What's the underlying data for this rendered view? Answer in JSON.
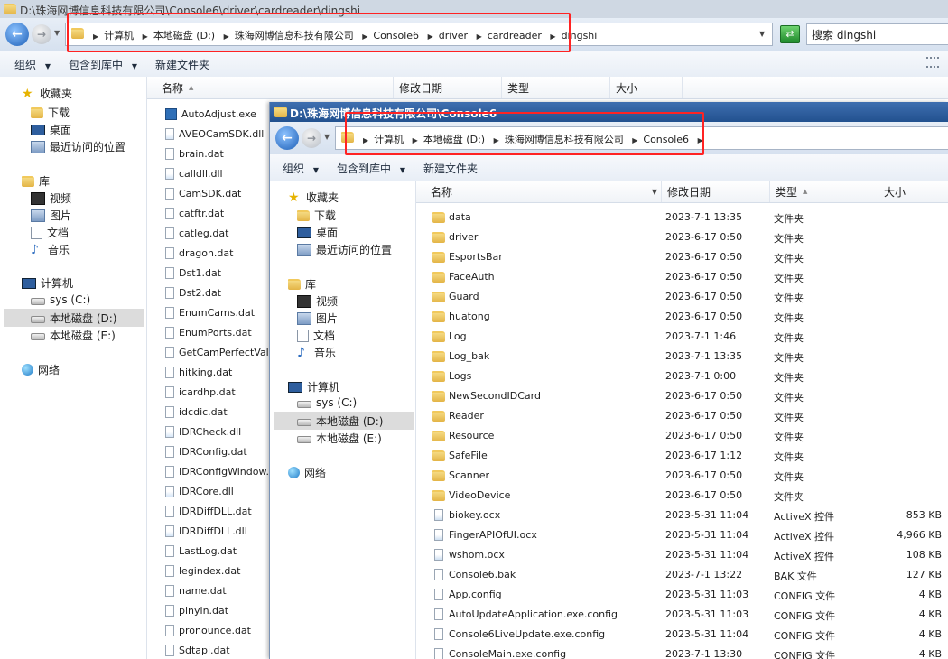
{
  "outer": {
    "title": "D:\\珠海网博信息科技有限公司\\Console6\\driver\\cardreader\\dingshi",
    "breadcrumbs": [
      "计算机",
      "本地磁盘 (D:)",
      "珠海网博信息科技有限公司",
      "Console6",
      "driver",
      "cardreader",
      "dingshi"
    ],
    "search_placeholder": "搜索 dingshi",
    "toolbar": {
      "organize": "组织",
      "include": "包含到库中",
      "new_folder": "新建文件夹"
    },
    "columns": [
      "名称",
      "修改日期",
      "类型",
      "大小"
    ],
    "nav": {
      "favorites": "收藏夹",
      "downloads": "下载",
      "desktop": "桌面",
      "recent": "最近访问的位置",
      "libraries": "库",
      "videos": "视频",
      "pictures": "图片",
      "documents": "文档",
      "music": "音乐",
      "computer": "计算机",
      "sys_c": "sys (C:)",
      "local_d": "本地磁盘 (D:)",
      "local_e": "本地磁盘 (E:)",
      "network": "网络"
    },
    "files": [
      {
        "name": "AutoAdjust.exe",
        "kind": "exe"
      },
      {
        "name": "AVEOCamSDK.dll",
        "kind": "dll"
      },
      {
        "name": "brain.dat",
        "kind": "dat"
      },
      {
        "name": "calldll.dll",
        "kind": "dll"
      },
      {
        "name": "CamSDK.dat",
        "kind": "dat"
      },
      {
        "name": "catftr.dat",
        "kind": "dat"
      },
      {
        "name": "catleg.dat",
        "kind": "dat"
      },
      {
        "name": "dragon.dat",
        "kind": "dat"
      },
      {
        "name": "Dst1.dat",
        "kind": "dat"
      },
      {
        "name": "Dst2.dat",
        "kind": "dat"
      },
      {
        "name": "EnumCams.dat",
        "kind": "dat"
      },
      {
        "name": "EnumPorts.dat",
        "kind": "dat"
      },
      {
        "name": "GetCamPerfectValue",
        "kind": "dat"
      },
      {
        "name": "hitking.dat",
        "kind": "dat"
      },
      {
        "name": "icardhp.dat",
        "kind": "dat"
      },
      {
        "name": "idcdic.dat",
        "kind": "dat"
      },
      {
        "name": "IDRCheck.dll",
        "kind": "dll"
      },
      {
        "name": "IDRConfig.dat",
        "kind": "dat"
      },
      {
        "name": "IDRConfigWindow.d",
        "kind": "dat"
      },
      {
        "name": "IDRCore.dll",
        "kind": "dll"
      },
      {
        "name": "IDRDiffDLL.dat",
        "kind": "dat"
      },
      {
        "name": "IDRDiffDLL.dll",
        "kind": "dll"
      },
      {
        "name": "LastLog.dat",
        "kind": "dat"
      },
      {
        "name": "legindex.dat",
        "kind": "dat"
      },
      {
        "name": "name.dat",
        "kind": "dat"
      },
      {
        "name": "pinyin.dat",
        "kind": "dat"
      },
      {
        "name": "pronounce.dat",
        "kind": "dat"
      },
      {
        "name": "Sdtapi.dat",
        "kind": "dat"
      }
    ]
  },
  "inner": {
    "title": "D:\\珠海网博信息科技有限公司\\Console6",
    "breadcrumbs": [
      "计算机",
      "本地磁盘 (D:)",
      "珠海网博信息科技有限公司",
      "Console6"
    ],
    "toolbar": {
      "organize": "组织",
      "include": "包含到库中",
      "new_folder": "新建文件夹"
    },
    "columns": [
      "名称",
      "修改日期",
      "类型",
      "大小"
    ],
    "rows": [
      {
        "name": "data",
        "date": "2023-7-1 13:35",
        "type": "文件夹",
        "size": "",
        "kind": "folder"
      },
      {
        "name": "driver",
        "date": "2023-6-17 0:50",
        "type": "文件夹",
        "size": "",
        "kind": "folder"
      },
      {
        "name": "EsportsBar",
        "date": "2023-6-17 0:50",
        "type": "文件夹",
        "size": "",
        "kind": "folder"
      },
      {
        "name": "FaceAuth",
        "date": "2023-6-17 0:50",
        "type": "文件夹",
        "size": "",
        "kind": "folder"
      },
      {
        "name": "Guard",
        "date": "2023-6-17 0:50",
        "type": "文件夹",
        "size": "",
        "kind": "folder"
      },
      {
        "name": "huatong",
        "date": "2023-6-17 0:50",
        "type": "文件夹",
        "size": "",
        "kind": "folder"
      },
      {
        "name": "Log",
        "date": "2023-7-1 1:46",
        "type": "文件夹",
        "size": "",
        "kind": "folder"
      },
      {
        "name": "Log_bak",
        "date": "2023-7-1 13:35",
        "type": "文件夹",
        "size": "",
        "kind": "folder"
      },
      {
        "name": "Logs",
        "date": "2023-7-1 0:00",
        "type": "文件夹",
        "size": "",
        "kind": "folder"
      },
      {
        "name": "NewSecondIDCard",
        "date": "2023-6-17 0:50",
        "type": "文件夹",
        "size": "",
        "kind": "folder"
      },
      {
        "name": "Reader",
        "date": "2023-6-17 0:50",
        "type": "文件夹",
        "size": "",
        "kind": "folder"
      },
      {
        "name": "Resource",
        "date": "2023-6-17 0:50",
        "type": "文件夹",
        "size": "",
        "kind": "folder"
      },
      {
        "name": "SafeFile",
        "date": "2023-6-17 1:12",
        "type": "文件夹",
        "size": "",
        "kind": "folder"
      },
      {
        "name": "Scanner",
        "date": "2023-6-17 0:50",
        "type": "文件夹",
        "size": "",
        "kind": "folder"
      },
      {
        "name": "VideoDevice",
        "date": "2023-6-17 0:50",
        "type": "文件夹",
        "size": "",
        "kind": "folder"
      },
      {
        "name": "biokey.ocx",
        "date": "2023-5-31 11:04",
        "type": "ActiveX 控件",
        "size": "853 KB",
        "kind": "ocx"
      },
      {
        "name": "FingerAPIOfUI.ocx",
        "date": "2023-5-31 11:04",
        "type": "ActiveX 控件",
        "size": "4,966 KB",
        "kind": "ocx"
      },
      {
        "name": "wshom.ocx",
        "date": "2023-5-31 11:04",
        "type": "ActiveX 控件",
        "size": "108 KB",
        "kind": "ocx"
      },
      {
        "name": "Console6.bak",
        "date": "2023-7-1 13:22",
        "type": "BAK 文件",
        "size": "127 KB",
        "kind": "file"
      },
      {
        "name": "App.config",
        "date": "2023-5-31 11:03",
        "type": "CONFIG 文件",
        "size": "4 KB",
        "kind": "file"
      },
      {
        "name": "AutoUpdateApplication.exe.config",
        "date": "2023-5-31 11:03",
        "type": "CONFIG 文件",
        "size": "4 KB",
        "kind": "file"
      },
      {
        "name": "Console6LiveUpdate.exe.config",
        "date": "2023-5-31 11:04",
        "type": "CONFIG 文件",
        "size": "4 KB",
        "kind": "file"
      },
      {
        "name": "ConsoleMain.exe.config",
        "date": "2023-7-1 13:30",
        "type": "CONFIG 文件",
        "size": "4 KB",
        "kind": "file"
      }
    ]
  },
  "colors": {
    "highlight": "#ff2323",
    "accent": "#2a6bbf",
    "selected": "#d9e7f7"
  }
}
